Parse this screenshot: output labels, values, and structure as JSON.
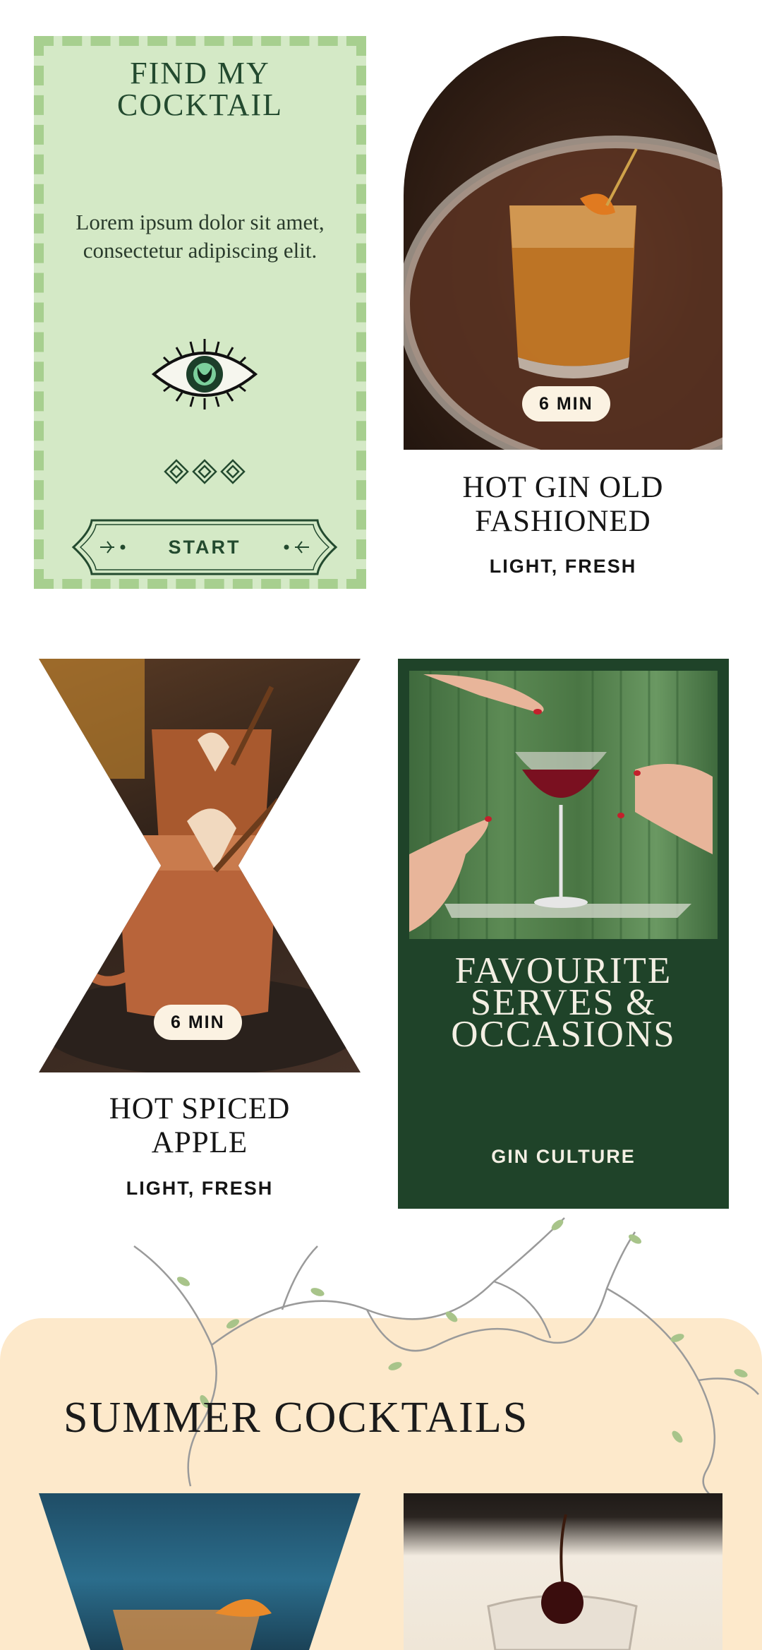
{
  "finder": {
    "title_line1": "FIND MY",
    "title_line2": "COCKTAIL",
    "desc_line1": "Lorem ipsum dolor sit amet,",
    "desc_line2": "consectetur adipiscing elit.",
    "start_label": "START"
  },
  "products": [
    {
      "title_line1": "HOT GIN OLD",
      "title_line2": "FASHIONED",
      "subtitle": "LIGHT, FRESH",
      "time": "6 MIN"
    },
    {
      "title_line1": "HOT SPICED",
      "title_line2": "APPLE",
      "subtitle": "LIGHT, FRESH",
      "time": "6 MIN"
    }
  ],
  "promo": {
    "title_line1": "FAVOURITE",
    "title_line2": "SERVES &",
    "title_line3": "OCCASIONS",
    "tag": "GIN CULTURE"
  },
  "summer": {
    "title": "SUMMER COCKTAILS"
  },
  "colors": {
    "finder_bg": "#d4e9c6",
    "finder_border": "#a7cf8f",
    "promo_bg": "#1f4329",
    "summer_bg": "#fde9cb"
  }
}
